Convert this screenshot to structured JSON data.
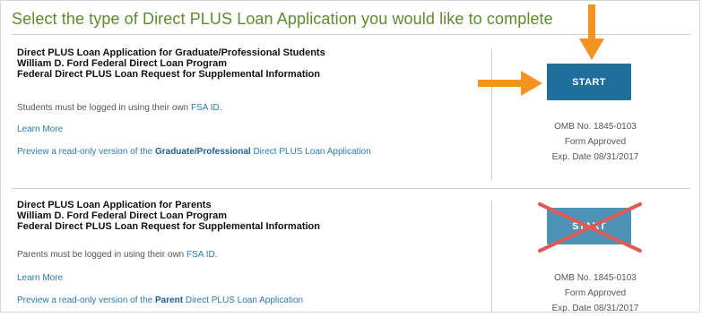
{
  "heading": "Select the type of Direct PLUS Loan Application you would like to complete",
  "sections": [
    {
      "title_lines": [
        "Direct PLUS Loan Application for Graduate/Professional Students",
        "William D. Ford Federal Direct Loan Program",
        "Federal Direct PLUS Loan Request for Supplemental Information"
      ],
      "login_text": "Students must be logged in using their own",
      "fsa_link": "FSA ID",
      "login_end": ".",
      "learn_more": "Learn More",
      "preview_prefix": "Preview a read-only version of the",
      "preview_link": "Graduate/Professional",
      "preview_suffix": "Direct PLUS Loan Application",
      "start_label": "START",
      "omb_lines": [
        "OMB No. 1845-0103",
        "Form Approved",
        "Exp. Date 08/31/2017"
      ]
    },
    {
      "title_lines": [
        "Direct PLUS Loan Application for Parents",
        "William D. Ford Federal Direct Loan Program",
        "Federal Direct PLUS Loan Request for Supplemental Information"
      ],
      "login_text": "Parents must be logged in using their own",
      "fsa_link": "FSA ID",
      "login_end": ".",
      "learn_more": "Learn More",
      "preview_prefix": "Preview a read-only version of the",
      "preview_link": "Parent",
      "preview_suffix": "Direct PLUS Loan Application",
      "start_label": "START",
      "omb_lines": [
        "OMB No. 1845-0103",
        "Form Approved",
        "Exp. Date 08/31/2017"
      ]
    }
  ],
  "colors": {
    "heading": "#5f8a2e",
    "button": "#1e6f9a",
    "link": "#2a7ab0",
    "arrow": "#f39321",
    "cross": "#e05a55"
  },
  "icons": [
    "down-arrow-icon",
    "right-arrow-icon",
    "red-cross-icon"
  ]
}
